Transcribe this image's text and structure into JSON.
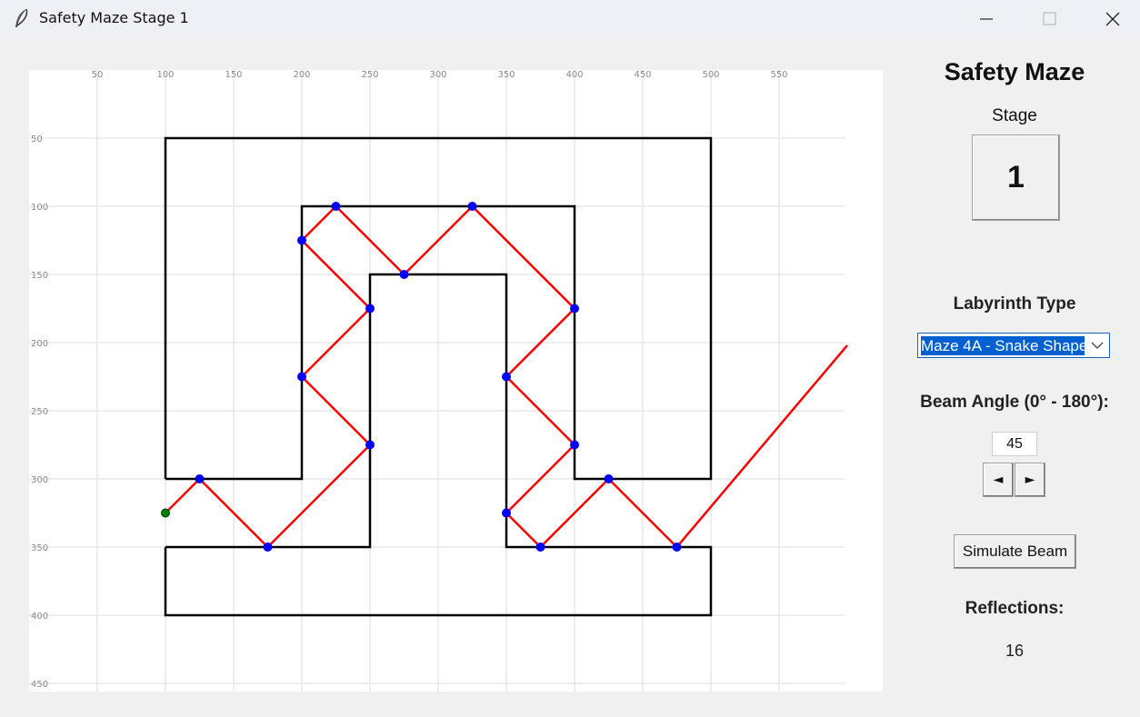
{
  "window": {
    "title": "Safety Maze Stage 1",
    "icon": "feather-icon",
    "controls": [
      "minimize-icon",
      "maximize-icon",
      "close-icon"
    ]
  },
  "panel": {
    "heading": "Safety Maze",
    "stage_label": "Stage",
    "stage_value": "1",
    "labyrinth_label": "Labyrinth Type",
    "labyrinth_selected": "Maze 4A - Snake Shape",
    "angle_label": "Beam Angle (0° - 180°):",
    "angle_value": "45",
    "decrease_label": "◄",
    "increase_label": "►",
    "simulate_label": "Simulate Beam",
    "reflections_label": "Reflections:",
    "reflections_value": "16"
  },
  "canvas": {
    "x_ticks": [
      50,
      100,
      150,
      200,
      250,
      300,
      350,
      400,
      450,
      500,
      550
    ],
    "y_ticks": [
      50,
      100,
      150,
      200,
      250,
      300,
      350,
      400,
      450
    ],
    "colors": {
      "grid": "#dedede",
      "walls": "#000000",
      "beam": "#ff0000",
      "reflection_point": "#0000ff",
      "origin_point": "#008000"
    },
    "walls": [
      [
        [
          100,
          300
        ],
        [
          100,
          50
        ],
        [
          500,
          50
        ],
        [
          500,
          300
        ],
        [
          400,
          300
        ],
        [
          400,
          100
        ],
        [
          200,
          100
        ],
        [
          200,
          300
        ],
        [
          100,
          300
        ]
      ],
      [
        [
          100,
          350
        ],
        [
          250,
          350
        ],
        [
          250,
          150
        ],
        [
          350,
          150
        ],
        [
          350,
          350
        ],
        [
          500,
          350
        ],
        [
          500,
          400
        ],
        [
          100,
          400
        ],
        [
          100,
          350
        ]
      ]
    ],
    "beam_path": [
      [
        100,
        325
      ],
      [
        125,
        300
      ],
      [
        175,
        350
      ],
      [
        250,
        275
      ],
      [
        200,
        225
      ],
      [
        250,
        175
      ],
      [
        200,
        125
      ],
      [
        225,
        100
      ],
      [
        275,
        150
      ],
      [
        325,
        100
      ],
      [
        400,
        175
      ],
      [
        350,
        225
      ],
      [
        400,
        275
      ],
      [
        350,
        325
      ],
      [
        375,
        350
      ],
      [
        425,
        300
      ],
      [
        475,
        350
      ],
      [
        600,
        202
      ]
    ],
    "origin": [
      100,
      325
    ],
    "reflections": [
      [
        125,
        300
      ],
      [
        175,
        350
      ],
      [
        250,
        275
      ],
      [
        200,
        225
      ],
      [
        250,
        175
      ],
      [
        200,
        125
      ],
      [
        225,
        100
      ],
      [
        275,
        150
      ],
      [
        325,
        100
      ],
      [
        400,
        175
      ],
      [
        350,
        225
      ],
      [
        400,
        275
      ],
      [
        350,
        325
      ],
      [
        375,
        350
      ],
      [
        425,
        300
      ],
      [
        475,
        350
      ]
    ]
  }
}
